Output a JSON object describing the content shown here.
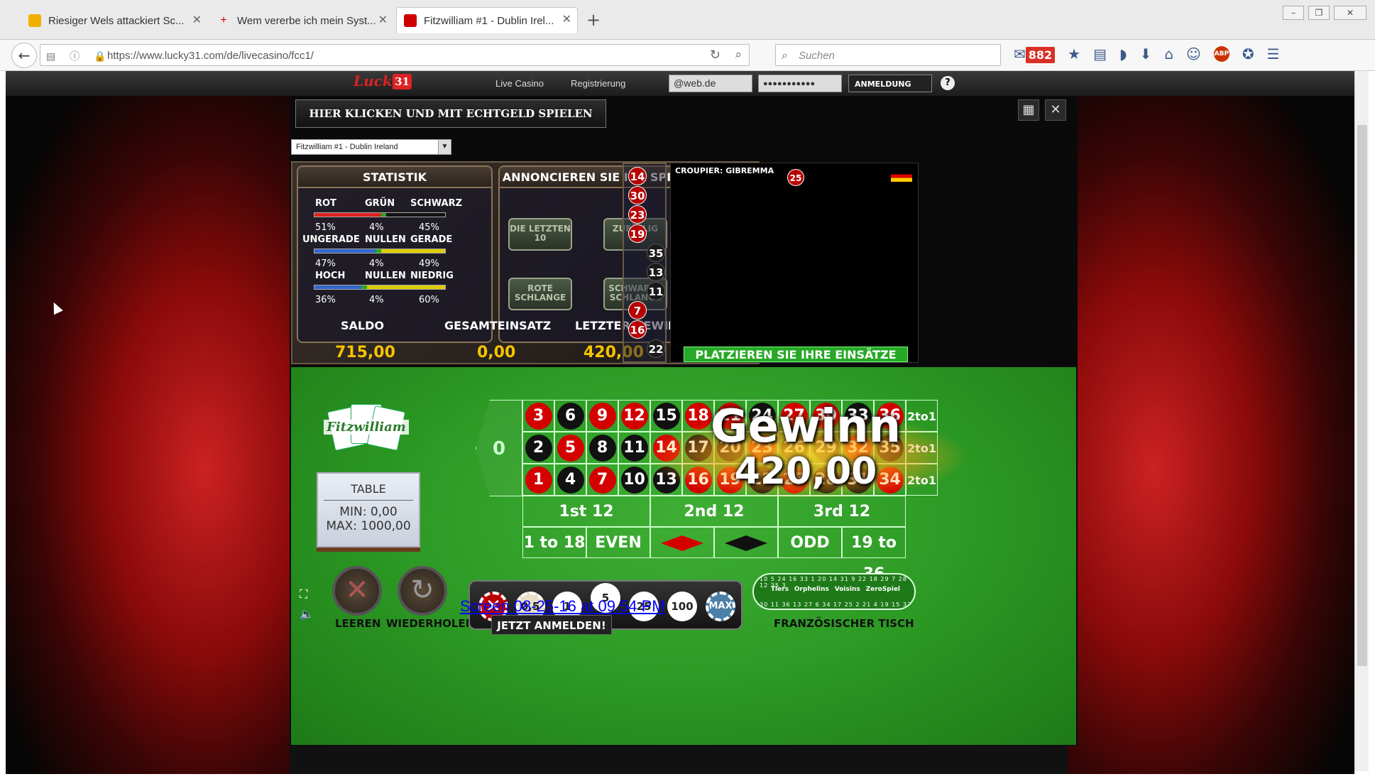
{
  "browser": {
    "tabs": [
      {
        "label": "Riesiger Wels attackiert Sc...",
        "color": "#f0b000"
      },
      {
        "label": "Wem vererbe ich mein Syst...",
        "color": "#d00"
      },
      {
        "label": "Fitzwilliam #1 - Dublin Irel...",
        "color": "#c00"
      }
    ],
    "url": "https://www.lucky31.com/de/livecasino/fcc1/",
    "search_placeholder": "Suchen",
    "mail_count": "882",
    "window_controls": [
      "–",
      "❐",
      "✕"
    ]
  },
  "site": {
    "logo": "Lucky",
    "logo_badge": "31",
    "nav": [
      "Live Casino",
      "Registrierung"
    ],
    "email_value": "@web.de",
    "password_mask": "●●●●●●●●●●●",
    "login_label": "ANMELDUNG",
    "help": "?"
  },
  "game": {
    "real_money_button": "HIER KLICKEN UND MIT ECHTGELD SPIELEN",
    "table_select": "Fitzwilliam #1 - Dublin Ireland",
    "stats": {
      "header": "STATISTIK",
      "rows": [
        {
          "labels": [
            "ROT",
            "GRÜN",
            "SCHWARZ"
          ],
          "pcts": [
            "51%",
            "4%",
            "45%"
          ]
        },
        {
          "labels": [
            "UNGERADE",
            "NULLEN",
            "GERADE"
          ],
          "pcts": [
            "47%",
            "4%",
            "49%"
          ]
        },
        {
          "labels": [
            "HOCH",
            "NULLEN",
            "NIEDRIG"
          ],
          "pcts": [
            "36%",
            "4%",
            "60%"
          ]
        }
      ]
    },
    "announce": {
      "header": "ANNONCIEREN SIE IHR SPIEL",
      "buttons": [
        [
          "DIE LETZTEN",
          "10"
        ],
        [
          "ZUFÄLLIG",
          "5"
        ],
        [
          "ROTE",
          "SCHLANGE"
        ],
        [
          "SCHWARZE",
          "SCHLANGE"
        ]
      ]
    },
    "summary": {
      "labels": [
        "SALDO",
        "GESAMTEINSATZ",
        "LETZTER GEWINN"
      ],
      "values": [
        "715,00",
        "0,00",
        "420,00"
      ]
    },
    "history": [
      {
        "n": "14",
        "c": "r"
      },
      {
        "n": "30",
        "c": "r"
      },
      {
        "n": "23",
        "c": "r"
      },
      {
        "n": "19",
        "c": "r"
      },
      {
        "n": "35",
        "c": "b"
      },
      {
        "n": "13",
        "c": "b"
      },
      {
        "n": "11",
        "c": "b"
      },
      {
        "n": "7",
        "c": "r"
      },
      {
        "n": "16",
        "c": "r"
      },
      {
        "n": "22",
        "c": "b"
      }
    ],
    "croupier": "CROUPIER: GIBREMMA",
    "last_number": "25",
    "place_bets": "PLATZIEREN SIE IHRE EINSÄTZE",
    "club_name": "Fitzwilliam",
    "table_card": {
      "title": "TABLE",
      "min": "MIN:  0,00",
      "max": "MAX:  1000,00"
    },
    "zero": "0",
    "board": [
      [
        "3",
        "6",
        "9",
        "12",
        "15",
        "18",
        "21",
        "24",
        "27",
        "30",
        "33",
        "36"
      ],
      [
        "2",
        "5",
        "8",
        "11",
        "14",
        "17",
        "20",
        "23",
        "26",
        "29",
        "32",
        "35"
      ],
      [
        "1",
        "4",
        "7",
        "10",
        "13",
        "16",
        "19",
        "22",
        "25",
        "28",
        "31",
        "34"
      ]
    ],
    "two_to_one": "2to1",
    "dozens": [
      "1st 12",
      "2nd 12",
      "3rd 12"
    ],
    "even_money": [
      "1 to 18",
      "EVEN",
      "",
      "",
      "ODD",
      "19 to 36"
    ],
    "win_title": "Gewinn",
    "win_amount": "420,00",
    "controls": [
      "LEEREN",
      "WIEDERHOLEN"
    ],
    "chips": [
      "0,5",
      "1",
      "5",
      "25",
      "100",
      "MAX"
    ],
    "french_table": "FRANZÖSISCHER TISCH",
    "french_sections": [
      "Tiers",
      "Orphelins",
      "Voisins",
      "ZeroSpiel"
    ],
    "french_top": "10 5 24 16 33 1 20 14 31 9 22 18 29 7 28 12 35 3",
    "french_bottom": "30 11 36 13 27 6 34 17 25 2 21 4 19 15 32",
    "screenshot_stamp": "Screen 08-25-16 at 09.54 PM",
    "jetzt_button": "JETZT ANMELDEN!"
  },
  "colors": {
    "felt": "#2c9a24",
    "red": "#d40000",
    "black": "#111111",
    "gold": "#f5c400"
  }
}
